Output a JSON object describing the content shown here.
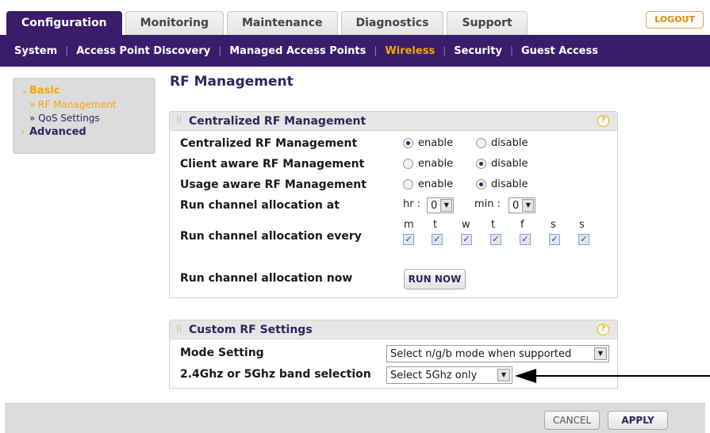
{
  "top_tabs": [
    {
      "label": "Configuration",
      "active": true
    },
    {
      "label": "Monitoring",
      "active": false
    },
    {
      "label": "Maintenance",
      "active": false
    },
    {
      "label": "Diagnostics",
      "active": false
    },
    {
      "label": "Support",
      "active": false
    }
  ],
  "logout_label": "LOGOUT",
  "subnav": [
    {
      "label": "System",
      "active": false
    },
    {
      "label": "Access Point Discovery",
      "active": false
    },
    {
      "label": "Managed Access Points",
      "active": false
    },
    {
      "label": "Wireless",
      "active": true
    },
    {
      "label": "Security",
      "active": false
    },
    {
      "label": "Guest Access",
      "active": false
    }
  ],
  "sidebar": {
    "basic": "Basic",
    "rf_management": "» RF Management",
    "qos_settings": "» QoS Settings",
    "advanced": "Advanced"
  },
  "page_title": "RF Management",
  "centralized": {
    "title": "Centralized RF Management",
    "help": "?",
    "rows": {
      "centralized_label": "Centralized RF Management",
      "client_label": "Client aware RF Management",
      "usage_label": "Usage aware RF Management",
      "alloc_at_label": "Run channel allocation at",
      "alloc_every_label": "Run channel allocation every",
      "alloc_now_label": "Run channel allocation now"
    },
    "enable": "enable",
    "disable": "disable",
    "centralized_value": "enable",
    "client_value": "disable",
    "usage_value": "disable",
    "hr_label": "hr :",
    "hr_value": "0",
    "min_label": "min :",
    "min_value": "0",
    "days": [
      "m",
      "t",
      "w",
      "t",
      "f",
      "s",
      "s"
    ],
    "days_checked": [
      true,
      true,
      true,
      true,
      true,
      true,
      true
    ],
    "run_now": "RUN NOW"
  },
  "custom": {
    "title": "Custom RF Settings",
    "help": "?",
    "mode_label": "Mode Setting",
    "mode_value": "Select n/g/b mode when supported",
    "band_label": "2.4Ghz or 5Ghz band selection",
    "band_value": "Select 5Ghz only"
  },
  "footer": {
    "cancel": "CANCEL",
    "apply": "APPLY"
  }
}
